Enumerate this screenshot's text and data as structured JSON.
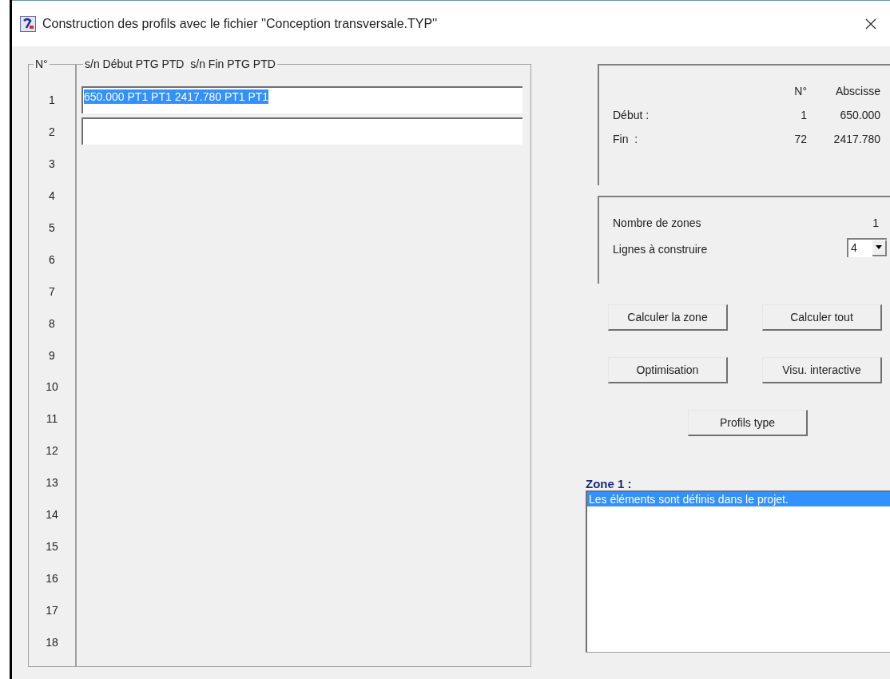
{
  "window": {
    "title": "Construction des profils avec le fichier ''Conception transversale.TYP''"
  },
  "profiles": {
    "number_header": "N°",
    "value_header": "s/n Début PTG PTD  s/n Fin PTG PTD",
    "rows": [
      {
        "number": "1",
        "kind": "field",
        "value": "650.000 PT1 PT1 2417.780 PT1 PT1",
        "selected": true
      },
      {
        "number": "2",
        "kind": "field"
      },
      {
        "number": "3",
        "kind": "empty"
      },
      {
        "number": "4",
        "kind": "empty"
      },
      {
        "number": "5",
        "kind": "empty"
      },
      {
        "number": "6",
        "kind": "empty"
      },
      {
        "number": "7",
        "kind": "empty"
      },
      {
        "number": "8",
        "kind": "empty"
      },
      {
        "number": "9",
        "kind": "empty"
      },
      {
        "number": "10",
        "kind": "empty"
      },
      {
        "number": "11",
        "kind": "empty"
      },
      {
        "number": "12",
        "kind": "empty"
      },
      {
        "number": "13",
        "kind": "empty"
      },
      {
        "number": "14",
        "kind": "empty"
      },
      {
        "number": "15",
        "kind": "empty"
      },
      {
        "number": "16",
        "kind": "empty"
      },
      {
        "number": "17",
        "kind": "empty"
      },
      {
        "number": "18",
        "kind": "empty"
      }
    ]
  },
  "range": {
    "columns": [
      "N°",
      "Abscisse"
    ],
    "rows": [
      {
        "label": "Début :",
        "number": "1",
        "abscissa": "650.000"
      },
      {
        "label": "Fin  :",
        "number": "72",
        "abscissa": "2417.780"
      }
    ]
  },
  "zones": {
    "count_label": "Nombre de zones",
    "count": "1",
    "lines_label": "Lignes à construire",
    "lines_value": "4"
  },
  "buttons": [
    [
      "Calculer la zone",
      "Calculer tout"
    ],
    [
      "Optimisation",
      "Visu. interactive"
    ],
    [
      "Profils type"
    ]
  ],
  "zone_list": {
    "title": "Zone 1 :",
    "items": [
      {
        "text": "Les éléments sont définis dans le projet.",
        "selected": true
      }
    ]
  }
}
